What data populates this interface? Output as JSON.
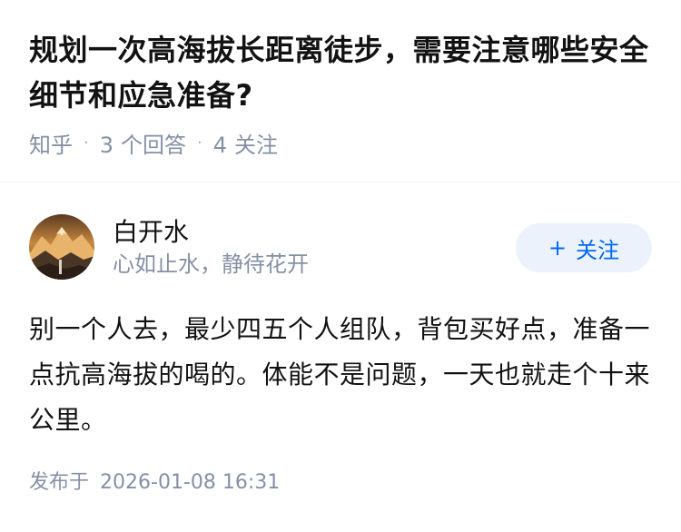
{
  "question": {
    "title": "规划一次高海拔长距离徒步，需要注意哪些安全细节和应急准备?",
    "source": "知乎",
    "answer_count": "3",
    "answer_label": "个回答",
    "follower_count": "4",
    "follower_label": "关注"
  },
  "answer": {
    "author": {
      "name": "白开水",
      "bio": "心如止水，静待花开",
      "avatar_icon": "mountain-landscape-avatar"
    },
    "follow_button": {
      "icon": "+",
      "label": "关注"
    },
    "content": "别一个人去，最少四五个人组队，背包买好点，准备一点抗高海拔的喝的。体能不是问题，一天也就走个十来公里。",
    "published_label": "发布于",
    "published_time": "2026-01-08 16:31"
  },
  "colors": {
    "title": "#121212",
    "meta": "#8590a6",
    "accent": "#0066ff",
    "follow_bg": "#ebf2fc"
  }
}
